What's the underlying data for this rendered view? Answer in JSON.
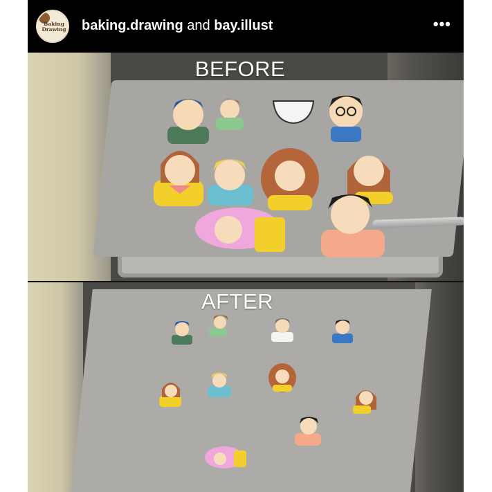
{
  "header": {
    "account_primary": "baking.drawing",
    "conjunction": "and",
    "account_secondary": "bay.illust",
    "avatar_text": "Baking Drawing",
    "menu_icon": "more-horizontal-icon"
  },
  "panels": {
    "before_label": "BEFORE",
    "after_label": "AFTER"
  },
  "colors": {
    "frame_background": "#000000",
    "header_text": "#ffffff",
    "parchment": "#a7a6a3",
    "tray_metal": "#b9b7b2"
  }
}
